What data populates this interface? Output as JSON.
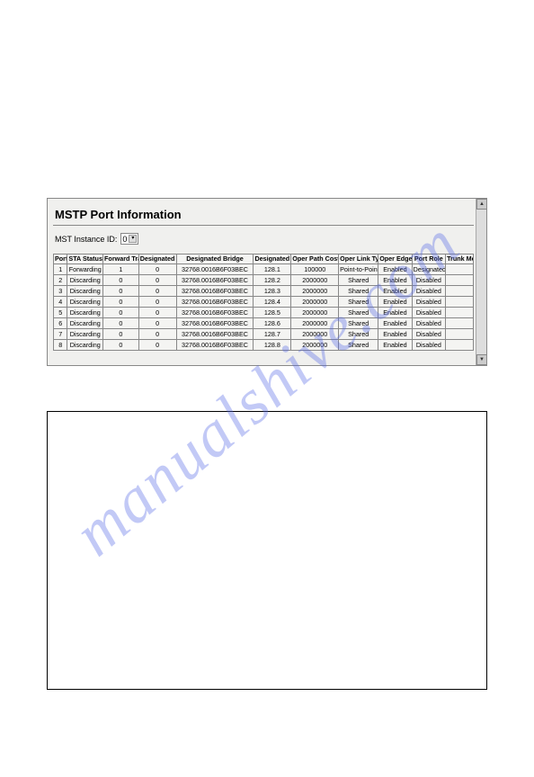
{
  "watermark": "manualshive.com",
  "panel": {
    "title": "MSTP Port Information",
    "instance_label": "MST Instance ID:",
    "instance_value": "0"
  },
  "headers": {
    "port": "Port",
    "sta": "STA Status",
    "fwd": "Forward Transitions",
    "dcost": "Designated Cost",
    "bridge": "Designated Bridge",
    "dport": "Designated Port",
    "opc": "Oper Path Cost",
    "olt": "Oper Link Type",
    "oep": "Oper Edge Port",
    "role": "Port Role",
    "trunk": "Trunk Member"
  },
  "rows": [
    {
      "port": "1",
      "sta": "Forwarding",
      "fwd": "1",
      "dcost": "0",
      "bridge": "32768.0016B6F03BEC",
      "dport": "128.1",
      "opc": "100000",
      "olt": "Point-to-Point",
      "oep": "Enabled",
      "role": "Designated",
      "trunk": ""
    },
    {
      "port": "2",
      "sta": "Discarding",
      "fwd": "0",
      "dcost": "0",
      "bridge": "32768.0016B6F03BEC",
      "dport": "128.2",
      "opc": "2000000",
      "olt": "Shared",
      "oep": "Enabled",
      "role": "Disabled",
      "trunk": ""
    },
    {
      "port": "3",
      "sta": "Discarding",
      "fwd": "0",
      "dcost": "0",
      "bridge": "32768.0016B6F03BEC",
      "dport": "128.3",
      "opc": "2000000",
      "olt": "Shared",
      "oep": "Enabled",
      "role": "Disabled",
      "trunk": ""
    },
    {
      "port": "4",
      "sta": "Discarding",
      "fwd": "0",
      "dcost": "0",
      "bridge": "32768.0016B6F03BEC",
      "dport": "128.4",
      "opc": "2000000",
      "olt": "Shared",
      "oep": "Enabled",
      "role": "Disabled",
      "trunk": ""
    },
    {
      "port": "5",
      "sta": "Discarding",
      "fwd": "0",
      "dcost": "0",
      "bridge": "32768.0016B6F03BEC",
      "dport": "128.5",
      "opc": "2000000",
      "olt": "Shared",
      "oep": "Enabled",
      "role": "Disabled",
      "trunk": ""
    },
    {
      "port": "6",
      "sta": "Discarding",
      "fwd": "0",
      "dcost": "0",
      "bridge": "32768.0016B6F03BEC",
      "dport": "128.6",
      "opc": "2000000",
      "olt": "Shared",
      "oep": "Enabled",
      "role": "Disabled",
      "trunk": ""
    },
    {
      "port": "7",
      "sta": "Discarding",
      "fwd": "0",
      "dcost": "0",
      "bridge": "32768.0016B6F03BEC",
      "dport": "128.7",
      "opc": "2000000",
      "olt": "Shared",
      "oep": "Enabled",
      "role": "Disabled",
      "trunk": ""
    },
    {
      "port": "8",
      "sta": "Discarding",
      "fwd": "0",
      "dcost": "0",
      "bridge": "32768.0016B6F03BEC",
      "dport": "128.8",
      "opc": "2000000",
      "olt": "Shared",
      "oep": "Enabled",
      "role": "Disabled",
      "trunk": ""
    }
  ]
}
